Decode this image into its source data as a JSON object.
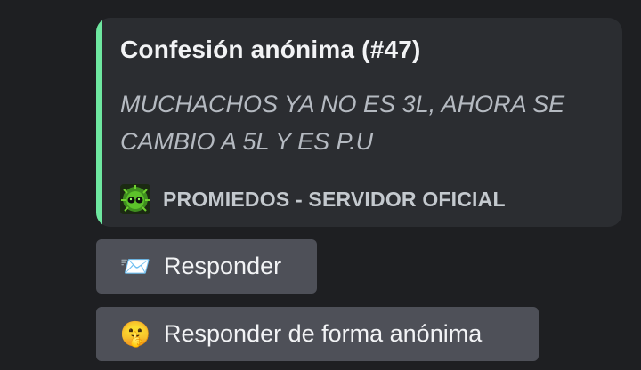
{
  "embed": {
    "title": "Confesión anónima (#47)",
    "description": "MUCHACHOS YA NO ES 3L, AHORA SE CAMBIO A 5L Y ES P.U",
    "footer_text": "PROMIEDOS - SERVIDOR OFICIAL",
    "footer_icon": "promiedos-server-logo-icon",
    "accent_color": "#6ee7a0"
  },
  "buttons": [
    {
      "icon": "envelope-incoming-icon",
      "emoji": "📨",
      "label": "Responder"
    },
    {
      "icon": "shushing-face-icon",
      "emoji": "🤫",
      "label": "Responder de forma anónima"
    }
  ]
}
